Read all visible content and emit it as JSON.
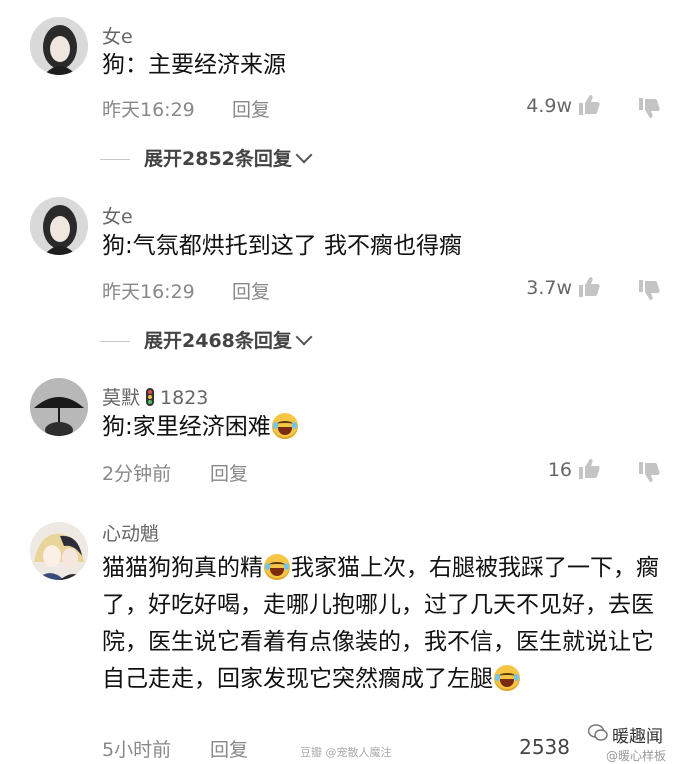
{
  "comments": [
    {
      "username": "女e",
      "text": "狗：主要经济来源",
      "time": "昨天16:29",
      "reply_label": "回复",
      "likes": "4.9w",
      "expand_label": "展开2852条回复"
    },
    {
      "username": "女e",
      "text": "狗:气氛都烘托到这了 我不瘸也得瘸",
      "time": "昨天16:29",
      "reply_label": "回复",
      "likes": "3.7w",
      "expand_label": "展开2468条回复"
    },
    {
      "username": "莫默",
      "level": "1823",
      "text": "狗:家里经济困难",
      "time": "2分钟前",
      "reply_label": "回复",
      "likes": "16"
    },
    {
      "username": "心动魈",
      "text_part1": "猫猫狗狗真的精",
      "text_part2": "我家猫上次，右腿被我踩了一下，瘸了，好吃好喝，走哪儿抱哪儿，过了几天不见好，去医院，医生说它看着有点像装的，我不信，医生就说让它自己走走，回家发现它突然瘸成了左腿",
      "time": "5小时前",
      "reply_label": "回复",
      "likes": "2538"
    }
  ],
  "watermarks": {
    "bottom_center": "豆瓣 @宠散人魔注",
    "brand": "暖趣闻",
    "brand_sub": "@暖心样板"
  },
  "colors": {
    "text": "#111111",
    "meta": "#888888",
    "emoji": "#f6c544"
  },
  "icons": [
    "thumbs-up-icon",
    "thumbs-down-icon",
    "chevron-down-icon",
    "grin-sweat-emoji",
    "level-badge-icon"
  ]
}
